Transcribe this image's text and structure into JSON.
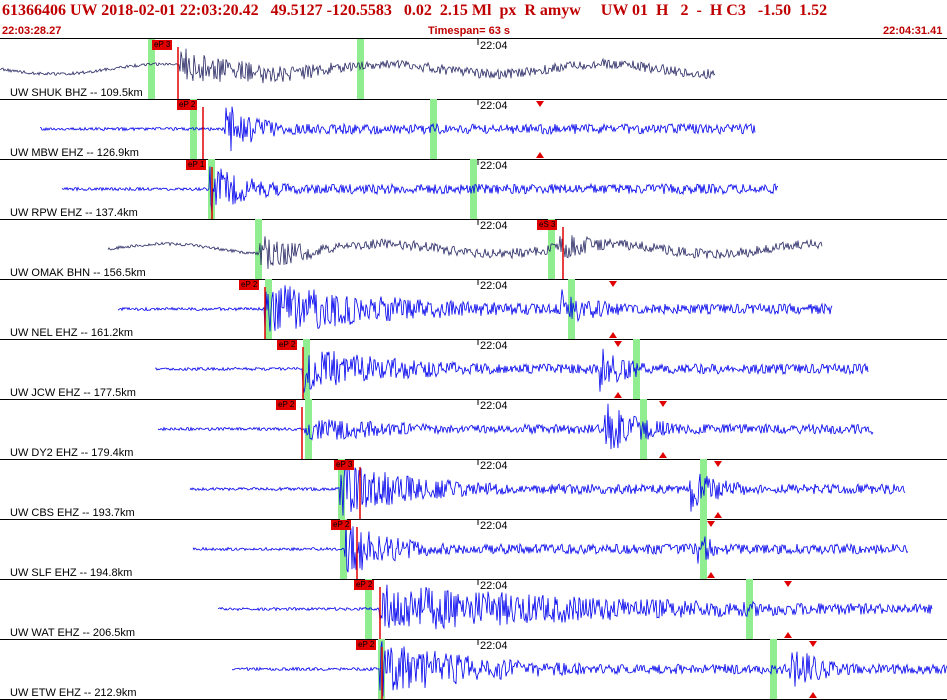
{
  "header": {
    "title": "61366406 UW 2018-02-01 22:03:20.42   49.5127 -120.5583   0.02  2.15 Ml  px  R amyw     UW 01  H   2  -  H C3   -1.50  1.52",
    "start_time": "22:03:28.27",
    "timespan": "Timespan=  63 s",
    "end_time": "22:04:31.41"
  },
  "colors": {
    "header_text": "#c00000",
    "trace": "#0000ee",
    "trace_dark": "#2a2a66",
    "pick": "#e00000",
    "window": "#90ee90"
  },
  "traces": [
    {
      "label": "UW SHUK BHZ -- 109.5km",
      "time": "22:04",
      "pick": "eP 3",
      "color": "dark"
    },
    {
      "label": "UW MBW EHZ -- 126.9km",
      "time": "22:04",
      "pick": "eP 2",
      "color": "blue"
    },
    {
      "label": "UW RPW EHZ -- 137.4km",
      "time": "22:04",
      "pick": "eP 1",
      "color": "blue"
    },
    {
      "label": "UW OMAK BHN -- 156.5km",
      "time": "22:04",
      "pick": "eS 3",
      "color": "dark"
    },
    {
      "label": "UW NEL EHZ -- 161.2km",
      "time": "22:04",
      "pick": "eP 2",
      "color": "blue"
    },
    {
      "label": "UW JCW EHZ -- 177.5km",
      "time": "22:04",
      "pick": "eP 2",
      "color": "blue"
    },
    {
      "label": "UW DY2 EHZ -- 179.4km",
      "time": "22:04",
      "pick": "eP 2",
      "color": "blue"
    },
    {
      "label": "UW CBS EHZ -- 193.7km",
      "time": "22:04",
      "pick": "eP 3",
      "color": "blue"
    },
    {
      "label": "UW SLF EHZ -- 194.8km",
      "time": "22:04",
      "pick": "eP 2",
      "color": "blue"
    },
    {
      "label": "UW WAT EHZ -- 206.5km",
      "time": "22:04",
      "pick": "eP 2",
      "color": "blue"
    },
    {
      "label": "UW ETW EHZ -- 212.9km",
      "time": "22:04",
      "pick": "eP 2",
      "color": "blue"
    }
  ]
}
